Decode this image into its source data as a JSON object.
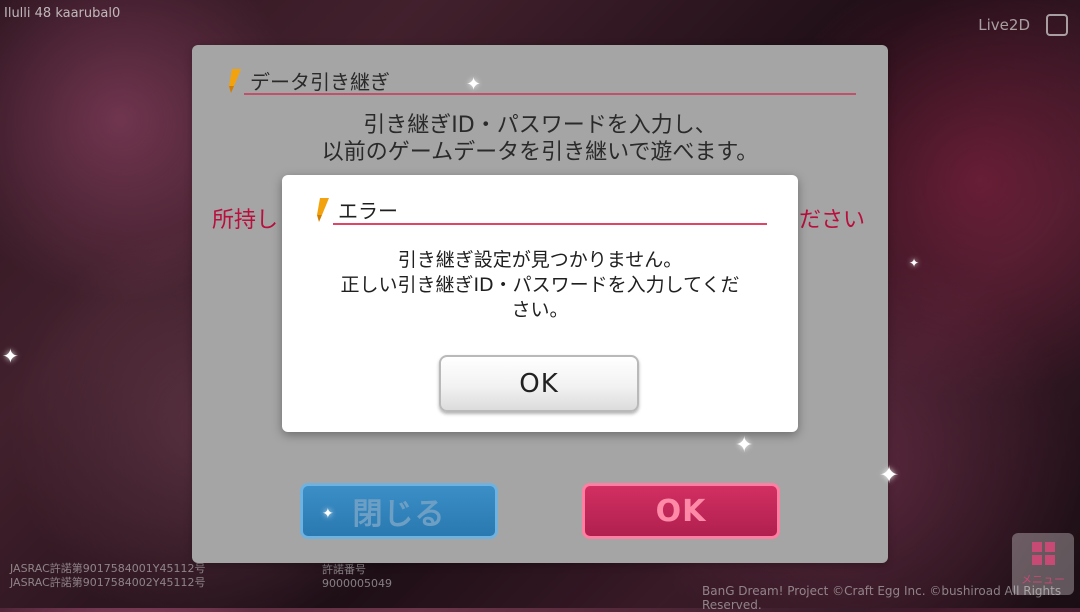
{
  "top_left_text": "Ilulli 48 kaarubal0",
  "top_right": {
    "live_text": "Live2D"
  },
  "back_dialog": {
    "title": "データ引き継ぎ",
    "message_line1": "引き継ぎID・パスワードを入力し、",
    "message_line2": "以前のゲームデータを引き継いで遊べます。",
    "red_left": "所持し",
    "red_right": "ださい",
    "close_label": "閉じる",
    "ok_label": "OK"
  },
  "error_dialog": {
    "title": "エラー",
    "message_line1": "引き継ぎ設定が見つかりません。",
    "message_line2": "正しい引き継ぎID・パスワードを入力してくだ",
    "message_line3": "さい。",
    "ok_label": "OK"
  },
  "footer": {
    "left_line1": "JASRAC許諾第9017584001Y45112号",
    "left_line2": "JASRAC許諾第9017584002Y45112号",
    "mid_line1": "許諾番号",
    "mid_line2": "9000005049",
    "copyright": "BanG Dream! Project ©Craft Egg Inc. ©bushiroad All Rights Reserved.",
    "menu_label": "メニュー"
  },
  "colors": {
    "accent_pink": "#d0224c",
    "close_button_blue": "#2a79b1",
    "ok_button_pink": "#b0204f"
  },
  "icons": [
    "pencil-icon",
    "menu-grid-icon",
    "cube-icon",
    "sparkle-icon"
  ]
}
